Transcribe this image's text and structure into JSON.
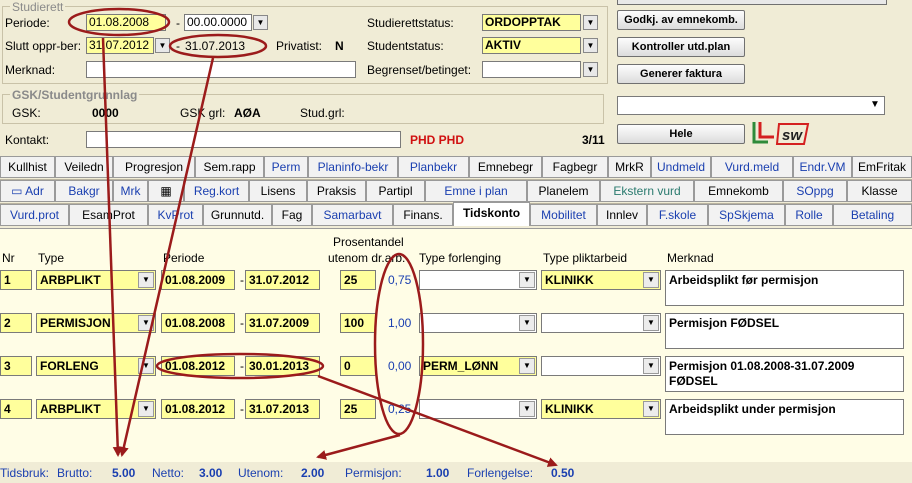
{
  "studierett": {
    "group_title": "Studierett",
    "periode_label": "Periode:",
    "periode_from": "01.08.2008",
    "periode_sep": "-",
    "periode_to": "00.00.0000",
    "slutt_label": "Slutt oppr-ber:",
    "slutt_value": "31.07.2012",
    "slutt_sep": "-",
    "slutt_extended": "31.07.2013",
    "privatist_label": "Privatist:",
    "privatist_value": "N",
    "merknad_label": "Merknad:",
    "merknad_value": "",
    "status_label": "Studierettstatus:",
    "status_value": "ORDOPPTAK",
    "studentstatus_label": "Studentstatus:",
    "studentstatus_value": "AKTIV",
    "begrenset_label": "Begrenset/betinget:",
    "begrenset_value": ""
  },
  "gsk": {
    "group_title": "GSK/Studentgrunnlag",
    "gsk_label": "GSK:",
    "gsk_value": "0000",
    "gskgrl_label": "GSK grl:",
    "gskgrl_value": "AØA",
    "studgrl_label": "Stud.grl:",
    "studgrl_value": ""
  },
  "kontakt": {
    "label": "Kontakt:",
    "value": "",
    "phd_text": "PHD PHD",
    "count": "3/11"
  },
  "buttons": {
    "godkj": "Godkj. av emnekomb.",
    "kontroller": "Kontroller utd.plan",
    "generer": "Generer faktura",
    "hele": "Hele",
    "right_dropdown": ""
  },
  "logo": {
    "text": "sw"
  },
  "tabs_row1": [
    "Kullhist",
    "Veiledn",
    "Progresjon",
    "Sem.rapp",
    "Perm",
    "Planinfo-bekr",
    "Planbekr",
    "Emnebegr",
    "Fagbegr",
    "MrkR",
    "Undmeld",
    "Vurd.meld",
    "Endr.VM",
    "EmFritak"
  ],
  "tabs_row2": [
    "Adr",
    "Bakgr",
    "Mrk",
    "",
    "Reg.kort",
    "Lisens",
    "Praksis",
    "Partipl",
    "Emne i plan",
    "Planelem",
    "Ekstern vurd",
    "Emnekomb",
    "SOppg",
    "Klasse"
  ],
  "tabs_row3": [
    "Vurd.prot",
    "EsamProt",
    "KvProt",
    "Grunnutd.",
    "Fag",
    "Samarbavt",
    "Finans.",
    "Tidskonto",
    "Mobilitet",
    "Innlev",
    "F.skole",
    "SpSkjema",
    "Rolle",
    "Betaling"
  ],
  "grid": {
    "headers": {
      "nr": "Nr",
      "type": "Type",
      "periode": "Periode",
      "prosent_line1": "Prosentandel",
      "prosent_line2": "utenom dr.arb.",
      "type_forlenging": "Type forlenging",
      "type_plikt": "Type pliktarbeid",
      "merknad": "Merknad"
    },
    "rows": [
      {
        "nr": "1",
        "type": "ARBPLIKT",
        "from": "01.08.2009",
        "to": "31.07.2012",
        "pct": "25",
        "val": "0,75",
        "forlenging": "",
        "plikt": "KLINIKK",
        "merknad": "Arbeidsplikt før permisjon"
      },
      {
        "nr": "2",
        "type": "PERMISJON",
        "from": "01.08.2008",
        "to": "31.07.2009",
        "pct": "100",
        "val": "1,00",
        "forlenging": "",
        "plikt": "",
        "merknad": "Permisjon FØDSEL"
      },
      {
        "nr": "3",
        "type": "FORLENG",
        "from": "01.08.2012",
        "to": "30.01.2013",
        "pct": "0",
        "val": "0,00",
        "forlenging": "PERM_LØNN",
        "plikt": "",
        "merknad": "Permisjon 01.08.2008-31.07.2009 FØDSEL"
      },
      {
        "nr": "4",
        "type": "ARBPLIKT",
        "from": "01.08.2012",
        "to": "31.07.2013",
        "pct": "25",
        "val": "0,25",
        "forlenging": "",
        "plikt": "KLINIKK",
        "merknad": "Arbeidsplikt under permisjon"
      }
    ],
    "dash": "-"
  },
  "footer": {
    "tidsbruk_label": "Tidsbruk:",
    "brutto_label": "Brutto:",
    "brutto_value": "5.00",
    "netto_label": "Netto:",
    "netto_value": "3.00",
    "utenom_label": "Utenom:",
    "utenom_value": "2.00",
    "permisjon_label": "Permisjon:",
    "permisjon_value": "1.00",
    "forlengelse_label": "Forlengelse:",
    "forlengelse_value": "0.50"
  },
  "colors": {
    "field_highlight": "#ffff9c",
    "annotation": "#9b1b1b",
    "link_blue": "#1a3fb0",
    "phd_red": "#d01010"
  }
}
